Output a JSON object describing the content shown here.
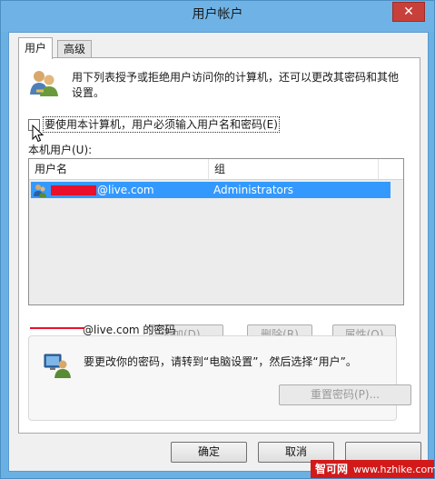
{
  "window": {
    "title": "用户帐户",
    "close_glyph": "✕"
  },
  "tabs": [
    {
      "label": "用户",
      "active": true
    },
    {
      "label": "高级",
      "active": false
    }
  ],
  "intro_text": "用下列表授予或拒绝用户访问你的计算机，还可以更改其密码和其他设置。",
  "require_password_checkbox": {
    "label": "要使用本计算机，用户必须输入用户名和密码(E)",
    "checked": false
  },
  "local_users_label": "本机用户(U):",
  "user_list": {
    "columns": [
      "用户名",
      "组"
    ],
    "rows": [
      {
        "user": "@live.com",
        "group": "Administrators",
        "selected": true
      }
    ]
  },
  "list_buttons": {
    "add": "添加(D)...",
    "remove": "删除(R)",
    "properties": "属性(O)"
  },
  "password_section": {
    "title": "@live.com 的密码",
    "text": "要更改你的密码，请转到“电脑设置”，然后选择“用户”。",
    "reset_button": "重置密码(P)..."
  },
  "dialog_buttons": {
    "ok": "确定",
    "cancel": "取消"
  },
  "watermark": {
    "site": "智可网",
    "url": "www.hzhike.com"
  },
  "colors": {
    "title_bar": "#6fb3e6",
    "selection": "#3399ff",
    "close": "#c8403a",
    "redaction": "#e8102a"
  }
}
